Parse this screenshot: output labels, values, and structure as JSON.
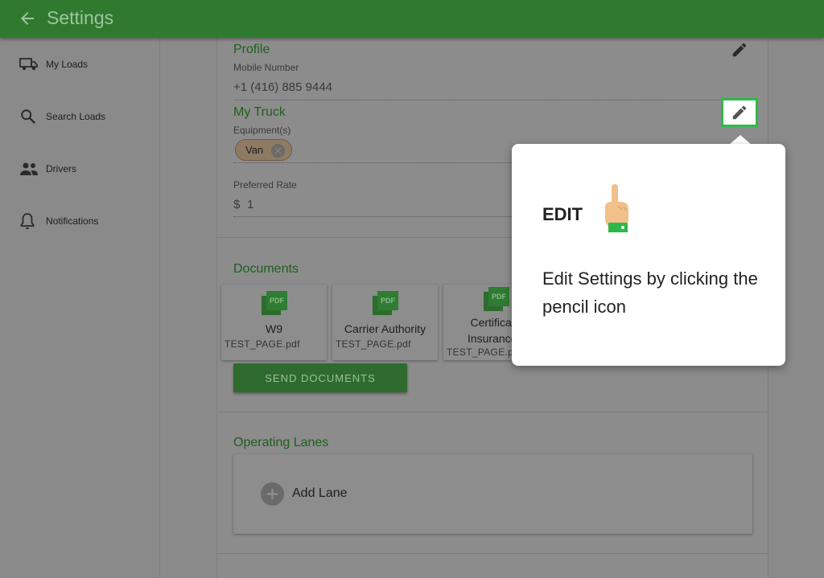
{
  "header": {
    "title": "Settings"
  },
  "sidebar": {
    "items": [
      {
        "label": "My Loads",
        "icon": "truck-icon"
      },
      {
        "label": "Search Loads",
        "icon": "search-icon"
      },
      {
        "label": "Drivers",
        "icon": "people-icon"
      },
      {
        "label": "Notifications",
        "icon": "bell-icon"
      }
    ]
  },
  "profile": {
    "title": "Profile",
    "mobile_label": "Mobile Number",
    "mobile_value": "+1 (416) 885 9444"
  },
  "truck": {
    "title": "My Truck",
    "equipment_label": "Equipment(s)",
    "equipment_chip": "Van",
    "rate_label": "Preferred Rate",
    "rate_currency": "$",
    "rate_value": "1"
  },
  "documents": {
    "title": "Documents",
    "items": [
      {
        "name": "W9",
        "file": "TEST_PAGE.pdf"
      },
      {
        "name": "Carrier Authority",
        "file": "TEST_PAGE.pdf"
      },
      {
        "name": "Certificate Insurance (",
        "file": "TEST_PAGE.pd"
      }
    ],
    "send_label": "SEND DOCUMENTS"
  },
  "lanes": {
    "title": "Operating Lanes",
    "add_label": "Add Lane"
  },
  "tutorial": {
    "title": "EDIT",
    "body": "Edit Settings by clicking the pencil icon",
    "highlight_color": "#2fb84a"
  },
  "colors": {
    "appbar": "#2f7a2f",
    "accent": "#2e7d32",
    "overlay": "#8a8a8a"
  }
}
